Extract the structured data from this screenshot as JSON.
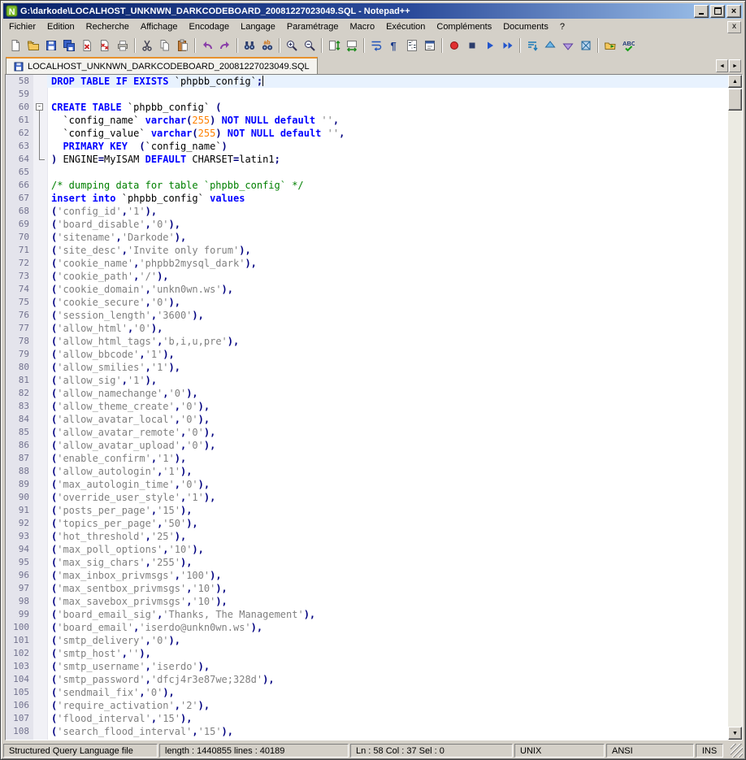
{
  "window": {
    "title": "G:\\darkode\\LOCALHOST_UNKNWN_DARKCODEBOARD_20081227023049.SQL - Notepad++",
    "controls": [
      "minimize-button",
      "restore-button",
      "close-button"
    ]
  },
  "menu": {
    "items": [
      {
        "id": "fichier",
        "label": "Fichier"
      },
      {
        "id": "edition",
        "label": "Edition"
      },
      {
        "id": "recherche",
        "label": "Recherche"
      },
      {
        "id": "affichage",
        "label": "Affichage"
      },
      {
        "id": "encodage",
        "label": "Encodage"
      },
      {
        "id": "langage",
        "label": "Langage"
      },
      {
        "id": "parametrage",
        "label": "Paramétrage"
      },
      {
        "id": "macro",
        "label": "Macro"
      },
      {
        "id": "execution",
        "label": "Exécution"
      },
      {
        "id": "complements",
        "label": "Compléments"
      },
      {
        "id": "documents",
        "label": "Documents"
      },
      {
        "id": "aide",
        "label": "?"
      }
    ],
    "close_button": "x"
  },
  "toolbar": {
    "groups": [
      [
        "new-file",
        "open-file",
        "save-file",
        "save-all",
        "close-file",
        "close-all",
        "print"
      ],
      [
        "cut",
        "copy",
        "paste"
      ],
      [
        "undo",
        "redo"
      ],
      [
        "find",
        "replace"
      ],
      [
        "zoom-in",
        "zoom-out"
      ],
      [
        "sync-vertical",
        "sync-horizontal"
      ],
      [
        "word-wrap",
        "show-symbols",
        "indent-guide",
        "user-dialog"
      ],
      [
        "record-macro",
        "stop-macro",
        "play-macro",
        "run-macro-multiple"
      ],
      [
        "plugin-sort",
        "plugin-up",
        "plugin-down",
        "plugin-box"
      ],
      [
        "explorer",
        "spell-check"
      ]
    ]
  },
  "tabs": {
    "active": {
      "label": "LOCALHOST_UNKNWN_DARKCODEBOARD_20081227023049.SQL"
    },
    "scroll_left": "◄",
    "scroll_right": "►"
  },
  "scrollbar": {
    "up": "▲",
    "down": "▼"
  },
  "editor": {
    "language": "SQL",
    "current_line": 58,
    "caret_col": 37,
    "colors": {
      "keyword": "#0000ff",
      "operator": "#000080",
      "number": "#ff8000",
      "string": "#808080",
      "comment": "#008000",
      "text": "#000000",
      "current_line_bg": "#e8f2fe",
      "line_number": "#73738f",
      "margin_bg": "#e4e4ec",
      "tab_accent": "#e8912d"
    },
    "lines": [
      {
        "n": 58,
        "toks": [
          [
            "kw",
            "DROP TABLE IF EXISTS"
          ],
          [
            "t",
            " `phpbb_config`"
          ],
          [
            "op",
            ";"
          ]
        ]
      },
      {
        "n": 59,
        "toks": []
      },
      {
        "n": 60,
        "fold": "open",
        "toks": [
          [
            "kw",
            "CREATE TABLE"
          ],
          [
            "t",
            " `phpbb_config` "
          ],
          [
            "op",
            "("
          ]
        ]
      },
      {
        "n": 61,
        "fold": "line",
        "toks": [
          [
            "t",
            "  `config_name` "
          ],
          [
            "kw",
            "varchar"
          ],
          [
            "op",
            "("
          ],
          [
            "num",
            "255"
          ],
          [
            "op",
            ")"
          ],
          [
            "t",
            " "
          ],
          [
            "kw",
            "NOT NULL default"
          ],
          [
            "t",
            " "
          ],
          [
            "str",
            "''"
          ],
          [
            "op",
            ","
          ]
        ]
      },
      {
        "n": 62,
        "fold": "line",
        "toks": [
          [
            "t",
            "  `config_value` "
          ],
          [
            "kw",
            "varchar"
          ],
          [
            "op",
            "("
          ],
          [
            "num",
            "255"
          ],
          [
            "op",
            ")"
          ],
          [
            "t",
            " "
          ],
          [
            "kw",
            "NOT NULL default"
          ],
          [
            "t",
            " "
          ],
          [
            "str",
            "''"
          ],
          [
            "op",
            ","
          ]
        ]
      },
      {
        "n": 63,
        "fold": "line",
        "toks": [
          [
            "t",
            "  "
          ],
          [
            "kw",
            "PRIMARY KEY"
          ],
          [
            "t",
            "  "
          ],
          [
            "op",
            "("
          ],
          [
            "t",
            "`config_name`"
          ],
          [
            "op",
            ")"
          ]
        ]
      },
      {
        "n": 64,
        "fold": "end",
        "toks": [
          [
            "op",
            ")"
          ],
          [
            "t",
            " ENGINE"
          ],
          [
            "op",
            "="
          ],
          [
            "t",
            "MyISAM "
          ],
          [
            "kw",
            "DEFAULT"
          ],
          [
            "t",
            " CHARSET"
          ],
          [
            "op",
            "="
          ],
          [
            "t",
            "latin1"
          ],
          [
            "op",
            ";"
          ]
        ]
      },
      {
        "n": 65,
        "toks": []
      },
      {
        "n": 66,
        "toks": [
          [
            "cmt",
            "/* dumping data for table `phpbb_config` */"
          ]
        ]
      },
      {
        "n": 67,
        "toks": [
          [
            "kw",
            "insert"
          ],
          [
            "t",
            " "
          ],
          [
            "kw",
            "into"
          ],
          [
            "t",
            " `phpbb_config` "
          ],
          [
            "kw",
            "values"
          ]
        ]
      },
      {
        "n": 68,
        "kv": [
          "config_id",
          "1"
        ]
      },
      {
        "n": 69,
        "kv": [
          "board_disable",
          "0"
        ]
      },
      {
        "n": 70,
        "kv": [
          "sitename",
          "Darkode"
        ]
      },
      {
        "n": 71,
        "kv": [
          "site_desc",
          "Invite only forum"
        ]
      },
      {
        "n": 72,
        "kv": [
          "cookie_name",
          "phpbb2mysql_dark"
        ]
      },
      {
        "n": 73,
        "kv": [
          "cookie_path",
          "/"
        ]
      },
      {
        "n": 74,
        "kv": [
          "cookie_domain",
          "unkn0wn.ws"
        ]
      },
      {
        "n": 75,
        "kv": [
          "cookie_secure",
          "0"
        ]
      },
      {
        "n": 76,
        "kv": [
          "session_length",
          "3600"
        ]
      },
      {
        "n": 77,
        "kv": [
          "allow_html",
          "0"
        ]
      },
      {
        "n": 78,
        "kv": [
          "allow_html_tags",
          "b,i,u,pre"
        ]
      },
      {
        "n": 79,
        "kv": [
          "allow_bbcode",
          "1"
        ]
      },
      {
        "n": 80,
        "kv": [
          "allow_smilies",
          "1"
        ]
      },
      {
        "n": 81,
        "kv": [
          "allow_sig",
          "1"
        ]
      },
      {
        "n": 82,
        "kv": [
          "allow_namechange",
          "0"
        ]
      },
      {
        "n": 83,
        "kv": [
          "allow_theme_create",
          "0"
        ]
      },
      {
        "n": 84,
        "kv": [
          "allow_avatar_local",
          "0"
        ]
      },
      {
        "n": 85,
        "kv": [
          "allow_avatar_remote",
          "0"
        ]
      },
      {
        "n": 86,
        "kv": [
          "allow_avatar_upload",
          "0"
        ]
      },
      {
        "n": 87,
        "kv": [
          "enable_confirm",
          "1"
        ]
      },
      {
        "n": 88,
        "kv": [
          "allow_autologin",
          "1"
        ]
      },
      {
        "n": 89,
        "kv": [
          "max_autologin_time",
          "0"
        ]
      },
      {
        "n": 90,
        "kv": [
          "override_user_style",
          "1"
        ]
      },
      {
        "n": 91,
        "kv": [
          "posts_per_page",
          "15"
        ]
      },
      {
        "n": 92,
        "kv": [
          "topics_per_page",
          "50"
        ]
      },
      {
        "n": 93,
        "kv": [
          "hot_threshold",
          "25"
        ]
      },
      {
        "n": 94,
        "kv": [
          "max_poll_options",
          "10"
        ]
      },
      {
        "n": 95,
        "kv": [
          "max_sig_chars",
          "255"
        ]
      },
      {
        "n": 96,
        "kv": [
          "max_inbox_privmsgs",
          "100"
        ]
      },
      {
        "n": 97,
        "kv": [
          "max_sentbox_privmsgs",
          "10"
        ]
      },
      {
        "n": 98,
        "kv": [
          "max_savebox_privmsgs",
          "10"
        ]
      },
      {
        "n": 99,
        "kv": [
          "board_email_sig",
          "Thanks, The Management"
        ]
      },
      {
        "n": 100,
        "kv": [
          "board_email",
          "iserdo@unkn0wn.ws"
        ]
      },
      {
        "n": 101,
        "kv": [
          "smtp_delivery",
          "0"
        ]
      },
      {
        "n": 102,
        "kv": [
          "smtp_host",
          ""
        ]
      },
      {
        "n": 103,
        "kv": [
          "smtp_username",
          "iserdo"
        ]
      },
      {
        "n": 104,
        "kv": [
          "smtp_password",
          "dfcj4r3e87we;328d"
        ]
      },
      {
        "n": 105,
        "kv": [
          "sendmail_fix",
          "0"
        ]
      },
      {
        "n": 106,
        "kv": [
          "require_activation",
          "2"
        ]
      },
      {
        "n": 107,
        "kv": [
          "flood_interval",
          "15"
        ]
      },
      {
        "n": 108,
        "kv": [
          "search_flood_interval",
          "15"
        ]
      }
    ]
  },
  "status": {
    "doc_type": "Structured Query Language file",
    "length_info": "length : 1440855  lines : 40189",
    "caret_info": "Ln : 58    Col : 37    Sel : 0",
    "eol": "UNIX",
    "encoding": "ANSI",
    "mode": "INS"
  }
}
